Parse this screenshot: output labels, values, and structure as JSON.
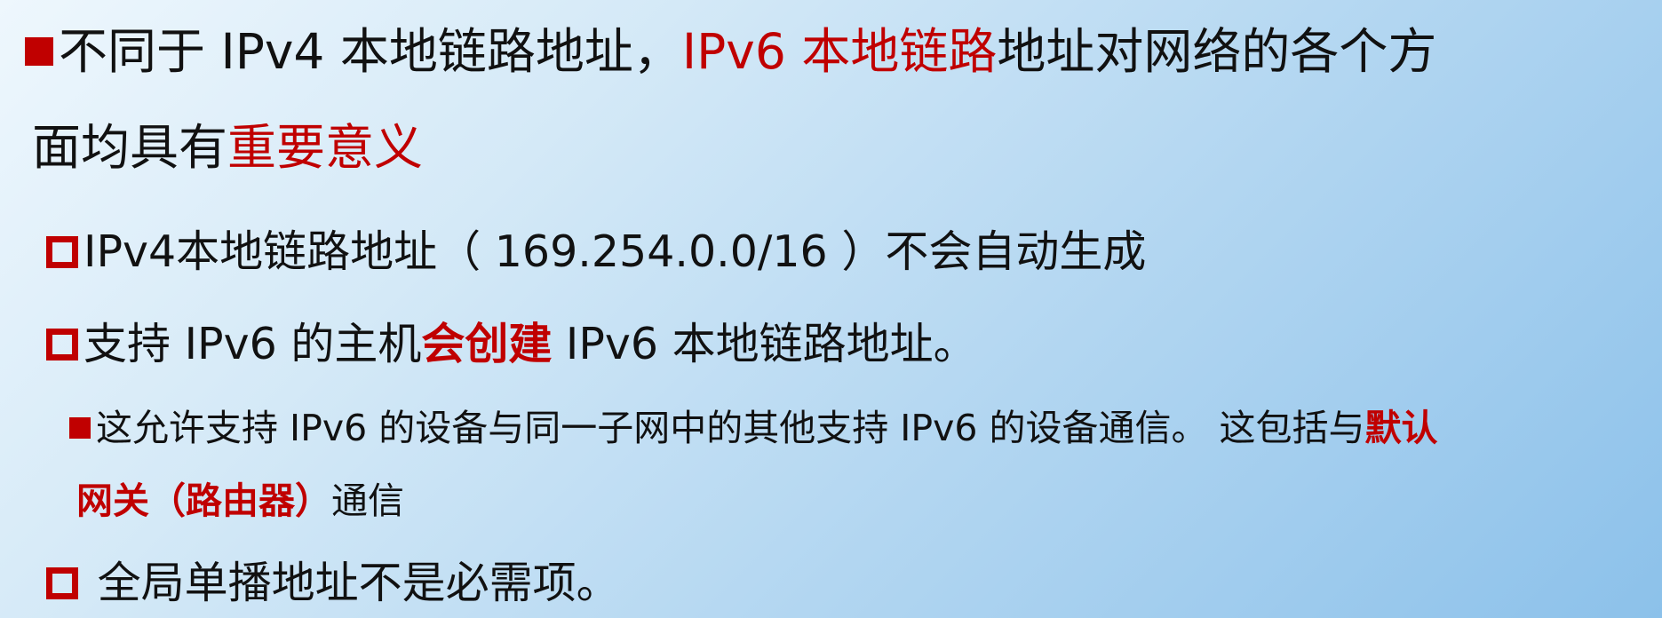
{
  "slide": {
    "bullet1": {
      "text_a": "不同于 IPv4 本地链路地址，",
      "text_red": "IPv6 本地链路",
      "text_b": "地址对网络的各个方"
    },
    "bullet1_cont": {
      "text_a": "面均具有",
      "text_red": "重要意义"
    },
    "sub1": {
      "text": "IPv4本地链路地址（ 169.254.0.0/16 ）不会自动生成"
    },
    "sub2": {
      "text_a": "支持 IPv6 的主机",
      "text_red_bold": "会创建",
      "text_b": " IPv6 本地链路地址。"
    },
    "subsub1": {
      "text_a": "这允许支持 IPv6 的设备与同一子网中的其他支持 IPv6 的设备通信。 这包括与",
      "text_red_bold": "默认"
    },
    "subsub1_cont": {
      "text_red_bold": "网关（路由器）",
      "text_b": "通信"
    },
    "sub3": {
      "text": " 全局单播地址不是必需项。"
    }
  },
  "colors": {
    "accent_red": "#c00000",
    "text": "#111111",
    "background_light": "#eef7fd",
    "background_dark": "#8cc1ea"
  }
}
